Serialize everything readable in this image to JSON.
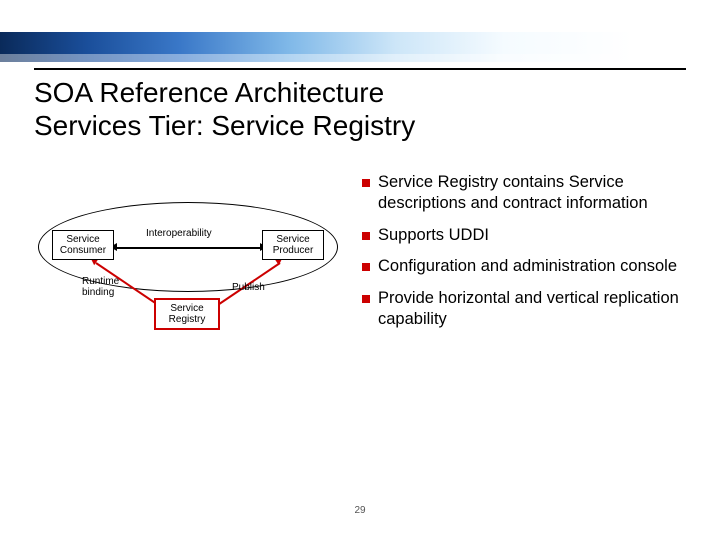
{
  "title": {
    "line1": "SOA Reference Architecture",
    "line2": "Services Tier: Service Registry"
  },
  "diagram": {
    "consumer": "Service Consumer",
    "producer": "Service Producer",
    "registry": "Service Registry",
    "interop": "Interoperability",
    "runtime1": "Runtime",
    "runtime2": "binding",
    "publish": "Publish"
  },
  "bullets": [
    "Service Registry contains Service descriptions and contract information",
    "Supports UDDI",
    "Configuration and administration console",
    "Provide horizontal and vertical replication capability"
  ],
  "page_number": "29"
}
